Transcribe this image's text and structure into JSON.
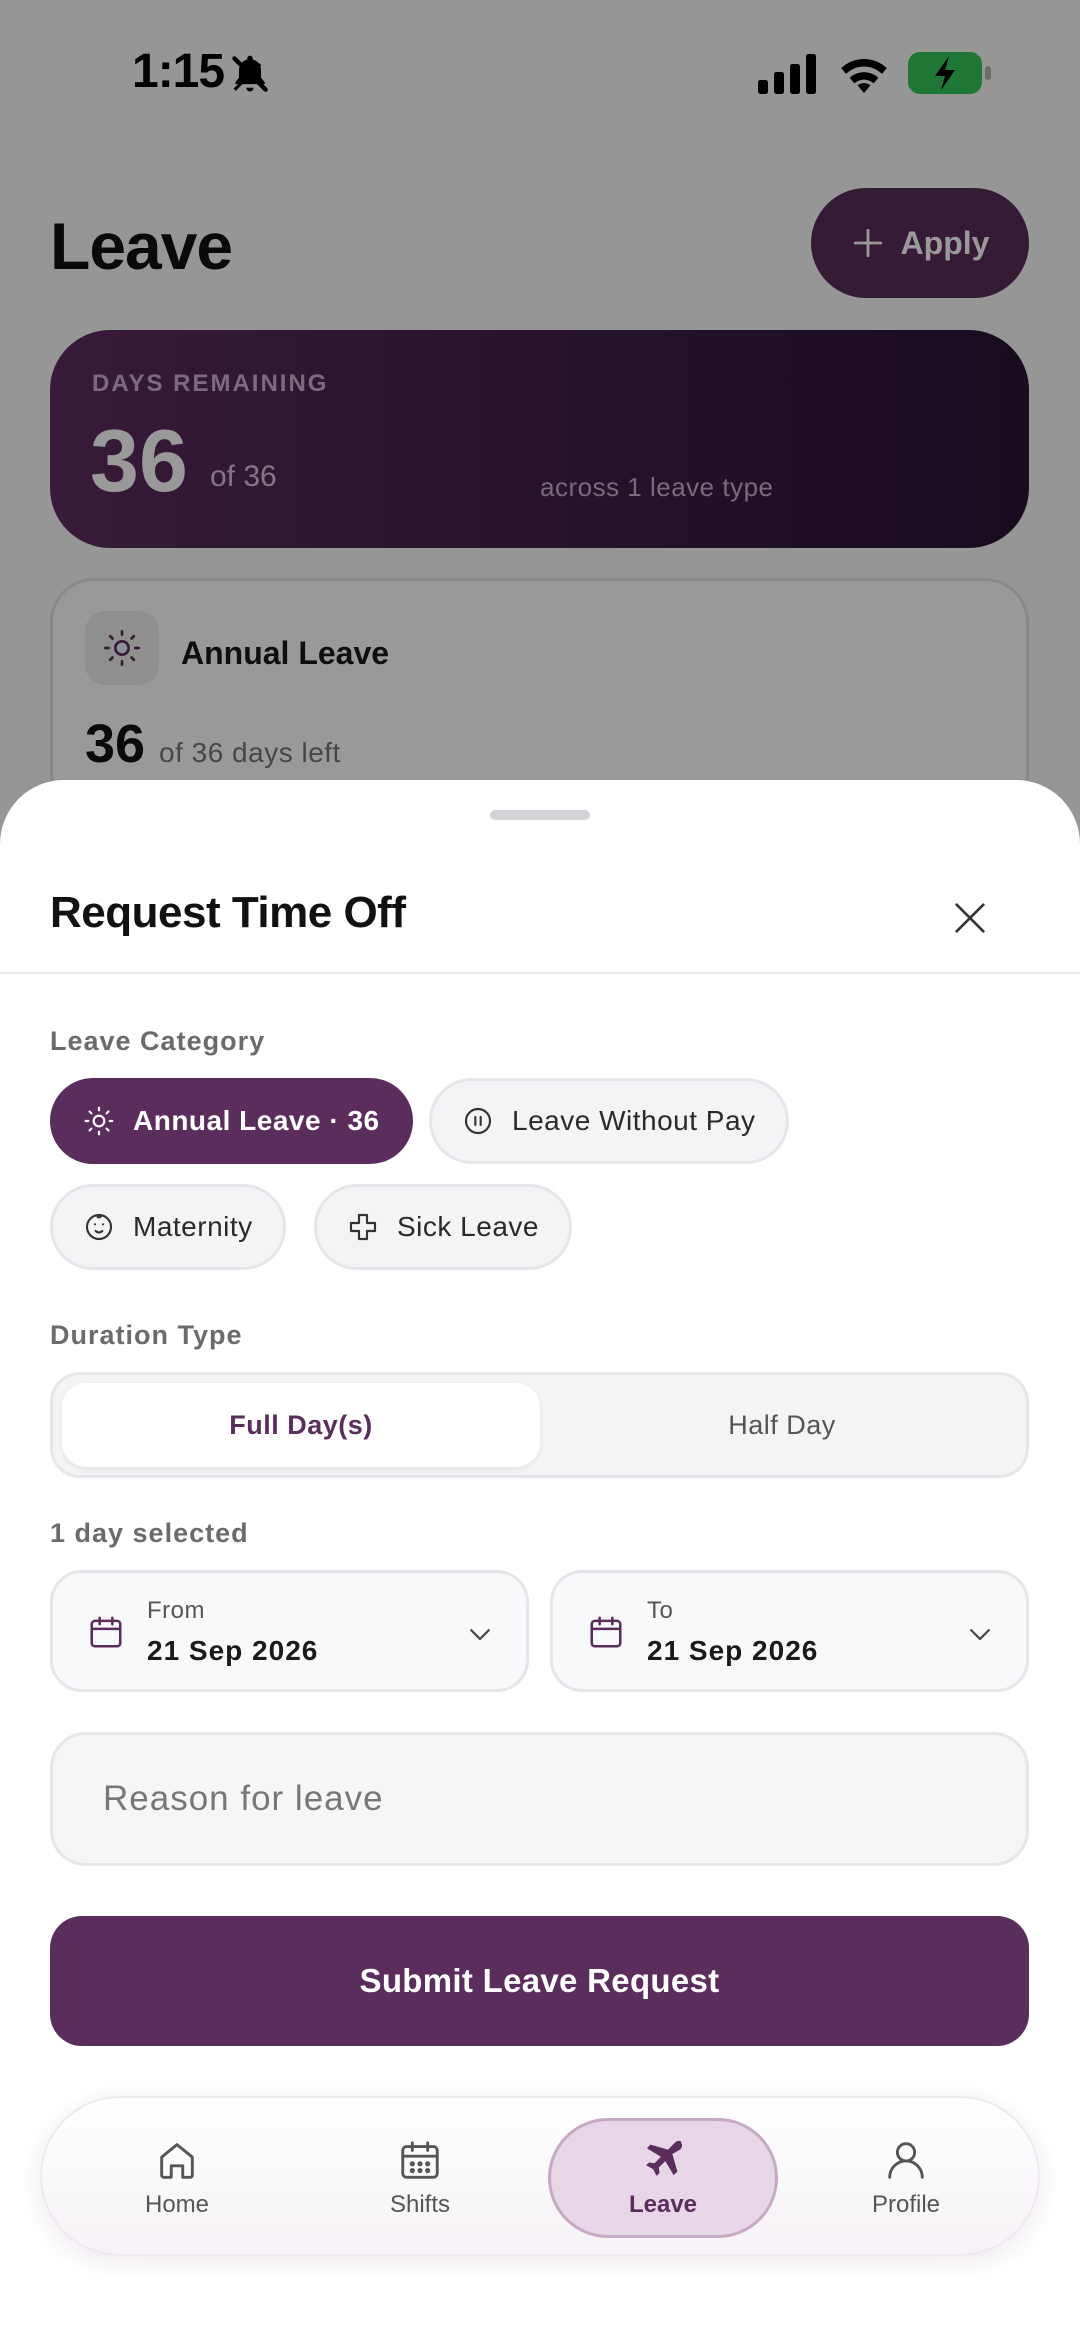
{
  "status_bar": {
    "time": "1:15"
  },
  "page": {
    "title": "Leave",
    "apply_label": "Apply",
    "summary": {
      "label": "DAYS REMAINING",
      "value": "36",
      "of_text": "of 36",
      "note": "across 1 leave type"
    },
    "leave_card": {
      "title": "Annual Leave",
      "value": "36",
      "of_text": "of 36 days left"
    }
  },
  "sheet": {
    "title": "Request Time Off",
    "leave_category_label": "Leave Category",
    "categories": [
      {
        "label": "Annual Leave · 36",
        "icon": "sun-icon",
        "selected": true
      },
      {
        "label": "Leave Without Pay",
        "icon": "pause-circle-icon",
        "selected": false
      },
      {
        "label": "Maternity",
        "icon": "baby-face-icon",
        "selected": false
      },
      {
        "label": "Sick Leave",
        "icon": "medical-cross-icon",
        "selected": false
      }
    ],
    "duration_label": "Duration Type",
    "duration_options": [
      "Full Day(s)",
      "Half Day"
    ],
    "duration_selected": "Full Day(s)",
    "days_selected_label": "1 day selected",
    "from": {
      "caption": "From",
      "value": "21 Sep 2026"
    },
    "to": {
      "caption": "To",
      "value": "21 Sep 2026"
    },
    "reason_placeholder": "Reason for leave",
    "submit_label": "Submit Leave Request"
  },
  "nav": [
    {
      "label": "Home",
      "icon": "home-icon",
      "active": false
    },
    {
      "label": "Shifts",
      "icon": "calendar-icon",
      "active": false
    },
    {
      "label": "Leave",
      "icon": "airplane-icon",
      "active": true
    },
    {
      "label": "Profile",
      "icon": "user-icon",
      "active": false
    }
  ],
  "colors": {
    "accent": "#5b2d5c",
    "accent_light": "#e7d6e6",
    "battery_green": "#34c759"
  }
}
